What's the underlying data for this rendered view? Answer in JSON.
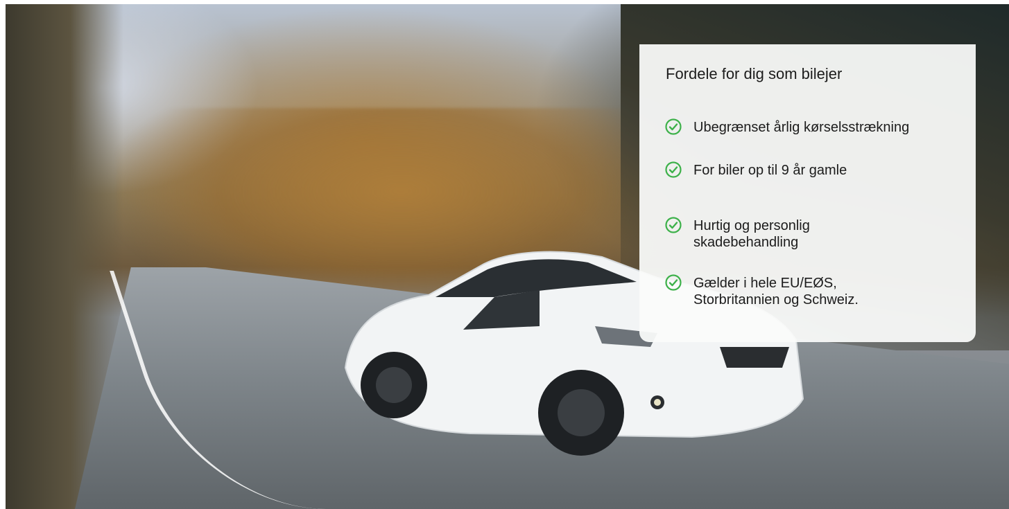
{
  "hero": {
    "image": "car-on-road-photo"
  },
  "benefits_panel": {
    "title": "Fordele for dig som bilejer",
    "check_icon": "check-circle-icon",
    "accent_color": "#3db14a",
    "items": [
      {
        "text": "Ubegrænset årlig kørselsstrækning"
      },
      {
        "text": "For biler op til 9 år gamle"
      },
      {
        "text": "Hurtig og personlig skadebehandling"
      },
      {
        "text": "Gælder i hele EU/EØS, Storbritannien og Schweiz."
      }
    ]
  }
}
